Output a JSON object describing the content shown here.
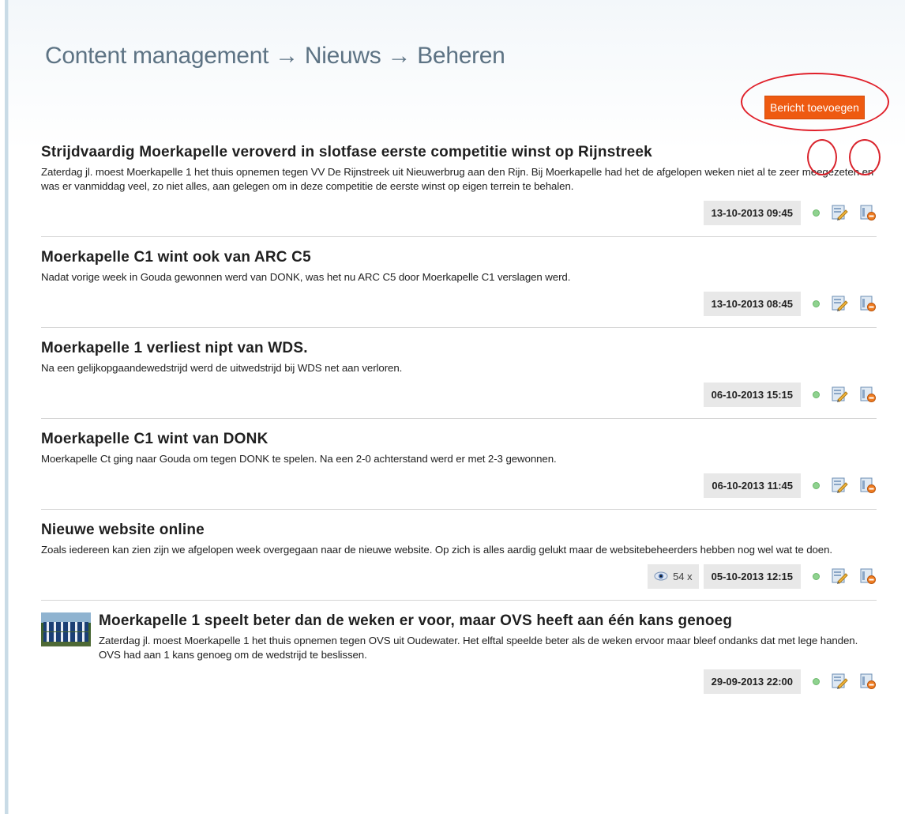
{
  "page": {
    "title": "Content management → Nieuws → Beheren",
    "add_button_label": "Bericht toevoegen"
  },
  "news": [
    {
      "title": "Strijdvaardig Moerkapelle veroverd in slotfase eerste competitie winst op Rijnstreek",
      "text": "Zaterdag jl. moest Moerkapelle 1 het thuis opnemen tegen VV De Rijnstreek uit Nieuwerbrug aan den Rijn. Bij Moerkapelle had het de afgelopen weken niet al te zeer meegezeten en was er vanmiddag veel, zo niet alles, aan gelegen om in deze competitie de eerste winst op eigen terrein te behalen.",
      "date": "13-10-2013 09:45"
    },
    {
      "title": "Moerkapelle C1 wint ook van ARC C5",
      "text": "Nadat vorige week in Gouda gewonnen werd van DONK, was het nu ARC C5 door Moerkapelle C1 verslagen werd.",
      "date": "13-10-2013 08:45"
    },
    {
      "title": "Moerkapelle 1 verliest nipt van WDS.",
      "text": "Na een gelijkopgaandewedstrijd werd de uitwedstrijd bij WDS net aan verloren.",
      "date": "06-10-2013 15:15"
    },
    {
      "title": "Moerkapelle C1 wint van DONK",
      "text": "Moerkapelle Ct ging naar Gouda om tegen DONK te spelen. Na een 2-0 achterstand werd er met 2-3 gewonnen.",
      "date": "06-10-2013 11:45"
    },
    {
      "title": "Nieuwe website online",
      "text": "Zoals iedereen kan zien zijn we afgelopen week overgegaan naar de nieuwe website. Op zich is alles aardig gelukt maar de websitebeheerders hebben nog wel wat te doen.",
      "views": "54 x",
      "date": "05-10-2013 12:15"
    },
    {
      "title": "Moerkapelle 1 speelt beter dan de weken er voor, maar OVS heeft aan één kans genoeg",
      "text": "Zaterdag jl. moest Moerkapelle 1 het thuis opnemen tegen OVS uit Oudewater. Het elftal speelde beter als de weken ervoor maar bleef ondanks dat met lege handen. OVS had aan 1 kans genoeg om de wedstrijd te beslissen.",
      "date": "29-09-2013 22:00"
    }
  ],
  "colors": {
    "accent_button": "#ee5a11",
    "annotation_circle": "#d9232c",
    "title_text": "#5d7384",
    "status_online": "#8fd28f"
  },
  "icons": {
    "edit": "edit-icon",
    "delete": "delete-icon",
    "views": "eye-icon",
    "status": "status-dot"
  }
}
